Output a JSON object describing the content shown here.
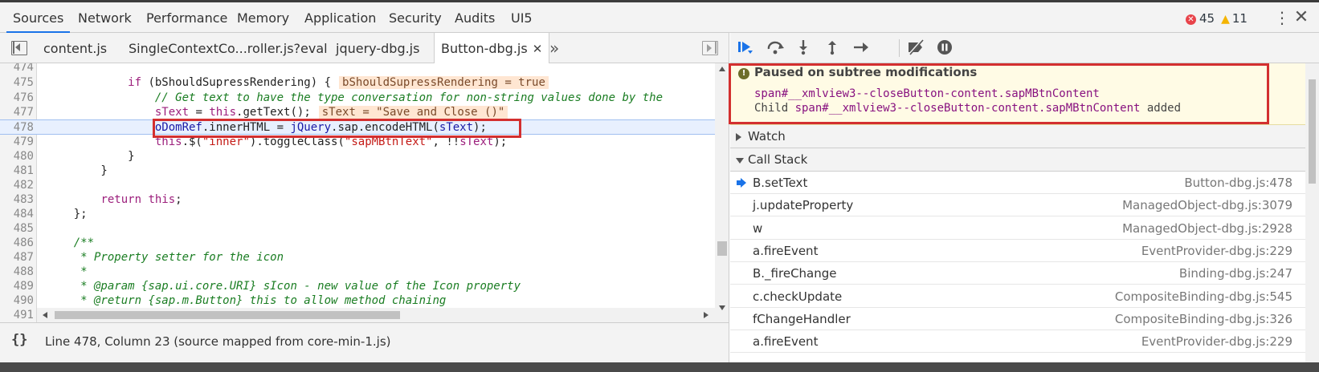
{
  "main_tabs": [
    "Sources",
    "Network",
    "Performance",
    "Memory",
    "Application",
    "Security",
    "Audits",
    "UI5"
  ],
  "active_main_tab": "Sources",
  "error_count": "45",
  "warning_count": "11",
  "file_tabs": [
    "content.js",
    "SingleContextCo...roller.js?eval",
    "jquery-dbg.js",
    "Button-dbg.js"
  ],
  "active_file_tab": "Button-dbg.js",
  "more_tabs_glyph": "»",
  "code": {
    "line_numbers": [
      "474",
      "475",
      "476",
      "477",
      "478",
      "479",
      "480",
      "481",
      "482",
      "483",
      "484",
      "485",
      "486",
      "487",
      "488",
      "489",
      "490",
      "491"
    ],
    "current_line": "478",
    "inline_values": {
      "l475": "bShouldSupressRendering = true",
      "l477": "sText = \"Save and Close ()\""
    }
  },
  "status": {
    "pretty_print_glyph": "{}",
    "text": "Line 478, Column 23   (source mapped from core-min-1.js)"
  },
  "debugger": {
    "paused_title": "Paused on subtree modifications",
    "paused_node": "span#__xmlview3--closeButton-content.sapMBtnContent",
    "paused_child_prefix": "Child ",
    "paused_child_node": "span#__xmlview3--closeButton-content.sapMBtnContent",
    "paused_child_suffix": " added",
    "watch_label": "Watch",
    "call_stack_label": "Call Stack",
    "call_stack": [
      {
        "fn": "B.setText",
        "loc": "Button-dbg.js:478"
      },
      {
        "fn": "j.updateProperty",
        "loc": "ManagedObject-dbg.js:3079"
      },
      {
        "fn": "w",
        "loc": "ManagedObject-dbg.js:2928"
      },
      {
        "fn": "a.fireEvent",
        "loc": "EventProvider-dbg.js:229"
      },
      {
        "fn": "B._fireChange",
        "loc": "Binding-dbg.js:247"
      },
      {
        "fn": "c.checkUpdate",
        "loc": "CompositeBinding-dbg.js:545"
      },
      {
        "fn": "fChangeHandler",
        "loc": "CompositeBinding-dbg.js:326"
      },
      {
        "fn": "a.fireEvent",
        "loc": "EventProvider-dbg.js:229"
      }
    ]
  },
  "colors": {
    "accent": "#1a73e8",
    "highlight_box": "#d32f2f",
    "paused_bg": "#fffbe5"
  }
}
